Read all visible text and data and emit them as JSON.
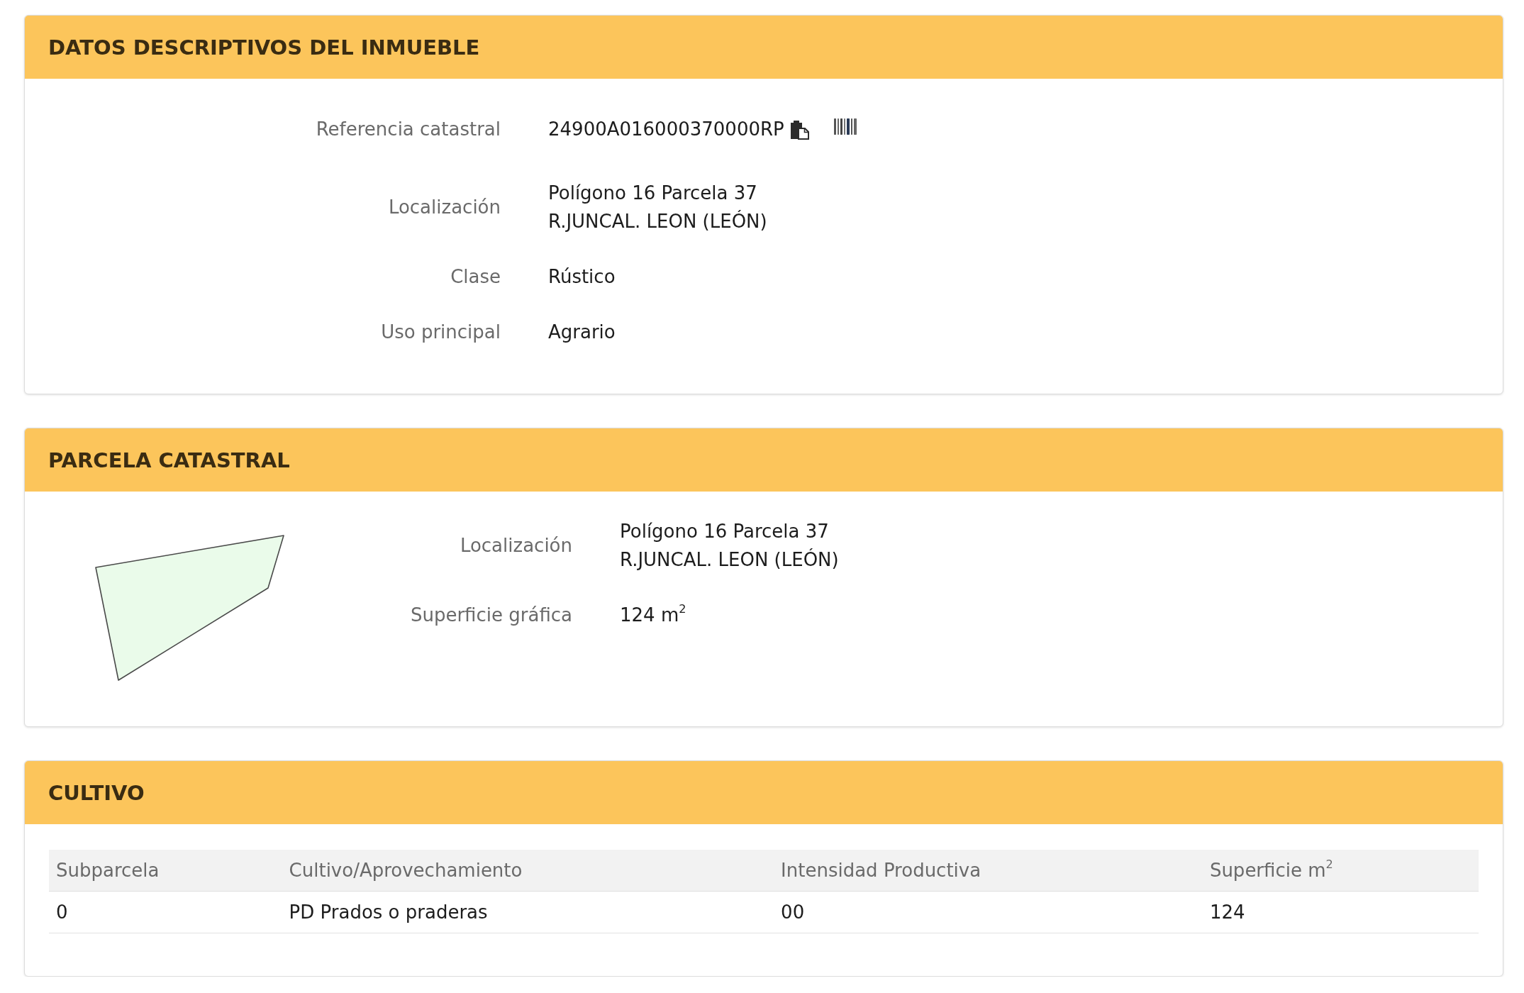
{
  "sections": [
    {
      "kind": "details",
      "title": "DATOS DESCRIPTIVOS DEL INMUEBLE",
      "fields": [
        {
          "kind": "reference",
          "label": "Referencia catastral",
          "lines": [
            "24900A016000370000RP"
          ]
        },
        {
          "kind": "text",
          "label": "Localización",
          "lines": [
            "Polígono 16 Parcela 37",
            "R.JUNCAL. LEON (LEÓN)"
          ]
        },
        {
          "kind": "text",
          "label": "Clase",
          "lines": [
            "Rústico"
          ]
        },
        {
          "kind": "text",
          "label": "Uso principal",
          "lines": [
            "Agrario"
          ]
        }
      ]
    },
    {
      "kind": "parcel",
      "title": "PARCELA CATASTRAL",
      "fields": [
        {
          "kind": "text",
          "label": "Localización",
          "lines": [
            "Polígono 16 Parcela 37",
            "R.JUNCAL. LEON (LEÓN)"
          ]
        },
        {
          "kind": "text",
          "label": "Superficie gráfica",
          "lines": [
            "124 m$^{2}$"
          ]
        }
      ]
    },
    {
      "kind": "table",
      "title": "CULTIVO",
      "table": {
        "columns": [
          "Subparcela",
          "Cultivo/Aprovechamiento",
          "Intensidad Productiva",
          "Superficie m$^{2}$"
        ],
        "rows": [
          [
            "0",
            "PD Prados o praderas",
            "00",
            "124"
          ]
        ]
      }
    }
  ]
}
